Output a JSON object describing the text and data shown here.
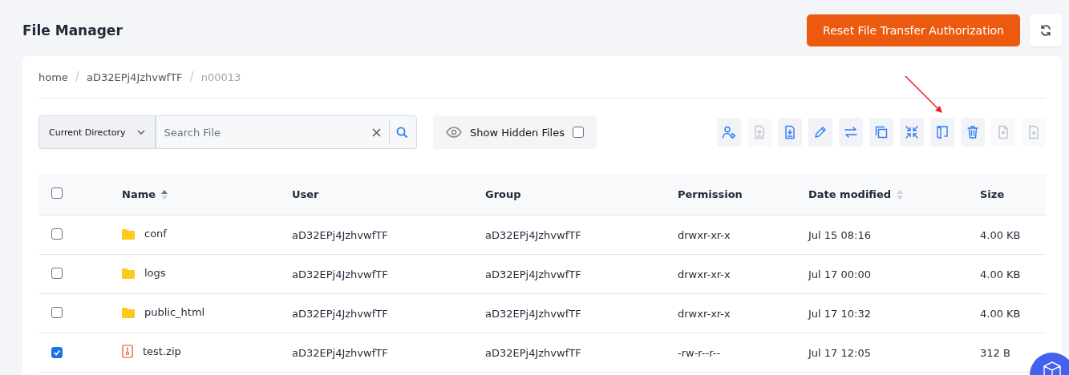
{
  "header": {
    "title": "File Manager",
    "reset_button": "Reset File Transfer Authorization"
  },
  "breadcrumb": {
    "separator": "/",
    "items": [
      {
        "label": "home",
        "current": false
      },
      {
        "label": "aD32EPj4JzhvwfTF",
        "current": false
      },
      {
        "label": "n00013",
        "current": true
      }
    ]
  },
  "search": {
    "scope": "Current Directory",
    "placeholder": "Search File"
  },
  "hidden_files": {
    "label": "Show Hidden Files",
    "checked": false
  },
  "toolbar": [
    {
      "kind": "owner",
      "disabled": false
    },
    {
      "kind": "upload",
      "disabled": true
    },
    {
      "kind": "download",
      "disabled": false
    },
    {
      "kind": "rename",
      "disabled": false
    },
    {
      "kind": "move",
      "disabled": false
    },
    {
      "kind": "copy",
      "disabled": false
    },
    {
      "kind": "compress",
      "disabled": false
    },
    {
      "kind": "extract",
      "disabled": false
    },
    {
      "kind": "delete",
      "disabled": false
    },
    {
      "kind": "new-folder",
      "disabled": true
    },
    {
      "kind": "new-file",
      "disabled": true
    }
  ],
  "table": {
    "all_checked": false,
    "columns": [
      {
        "label": "Name",
        "sorted": true
      },
      {
        "label": "User"
      },
      {
        "label": "Group"
      },
      {
        "label": "Permission"
      },
      {
        "label": "Date modified",
        "sorted": false
      },
      {
        "label": "Size"
      }
    ],
    "rows": [
      {
        "kind": "folder",
        "checked": false,
        "name": "conf",
        "user": "aD32EPj4JzhvwfTF",
        "group": "aD32EPj4JzhvwfTF",
        "permission": "drwxr-xr-x",
        "modified": "Jul 15 08:16",
        "size": "4.00 KB"
      },
      {
        "kind": "folder",
        "checked": false,
        "name": "logs",
        "user": "aD32EPj4JzhvwfTF",
        "group": "aD32EPj4JzhvwfTF",
        "permission": "drwxr-xr-x",
        "modified": "Jul 17 00:00",
        "size": "4.00 KB"
      },
      {
        "kind": "folder",
        "checked": false,
        "name": "public_html",
        "user": "aD32EPj4JzhvwfTF",
        "group": "aD32EPj4JzhvwfTF",
        "permission": "drwxr-xr-x",
        "modified": "Jul 17 10:32",
        "size": "4.00 KB"
      },
      {
        "kind": "zip",
        "checked": true,
        "name": "test.zip",
        "user": "aD32EPj4JzhvwfTF",
        "group": "aD32EPj4JzhvwfTF",
        "permission": "-rw-r--r--",
        "modified": "Jul 17 12:05",
        "size": "312 B"
      }
    ]
  }
}
